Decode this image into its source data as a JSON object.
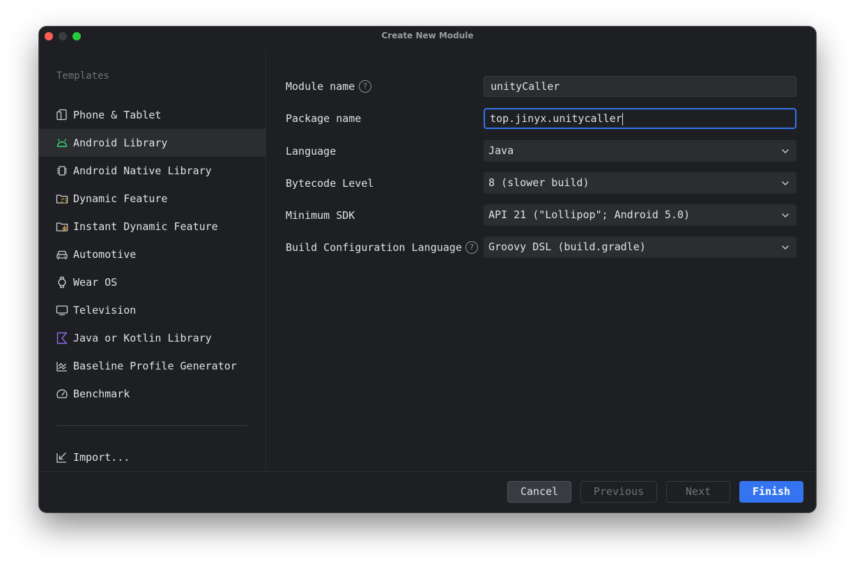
{
  "window": {
    "title": "Create New Module"
  },
  "sidebar": {
    "heading": "Templates",
    "items": [
      {
        "label": "Phone & Tablet",
        "icon": "phone-tablet-icon"
      },
      {
        "label": "Android Library",
        "icon": "android-icon",
        "selected": true
      },
      {
        "label": "Android Native Library",
        "icon": "chip-icon"
      },
      {
        "label": "Dynamic Feature",
        "icon": "folder-dynamic-icon"
      },
      {
        "label": "Instant Dynamic Feature",
        "icon": "folder-instant-icon"
      },
      {
        "label": "Automotive",
        "icon": "car-icon"
      },
      {
        "label": "Wear OS",
        "icon": "watch-icon"
      },
      {
        "label": "Television",
        "icon": "tv-icon"
      },
      {
        "label": "Java or Kotlin Library",
        "icon": "kotlin-icon"
      },
      {
        "label": "Baseline Profile Generator",
        "icon": "chart-icon"
      },
      {
        "label": "Benchmark",
        "icon": "gauge-icon"
      }
    ],
    "import_label": "Import..."
  },
  "form": {
    "module_name": {
      "label": "Module name",
      "value": "unityCaller"
    },
    "package_name": {
      "label": "Package name",
      "value": "top.jinyx.unitycaller"
    },
    "language": {
      "label": "Language",
      "value": "Java"
    },
    "bytecode_level": {
      "label": "Bytecode Level",
      "value": "8 (slower build)"
    },
    "minimum_sdk": {
      "label": "Minimum SDK",
      "value": "API 21 (\"Lollipop\"; Android 5.0)"
    },
    "build_config_language": {
      "label": "Build Configuration Language",
      "value": "Groovy DSL (build.gradle)"
    }
  },
  "buttons": {
    "cancel": "Cancel",
    "previous": "Previous",
    "next": "Next",
    "finish": "Finish"
  },
  "colors": {
    "accent": "#3574f0",
    "android_green": "#3ddc84",
    "kotlin_purple": "#8e6cf0",
    "background": "#1e1f22"
  }
}
